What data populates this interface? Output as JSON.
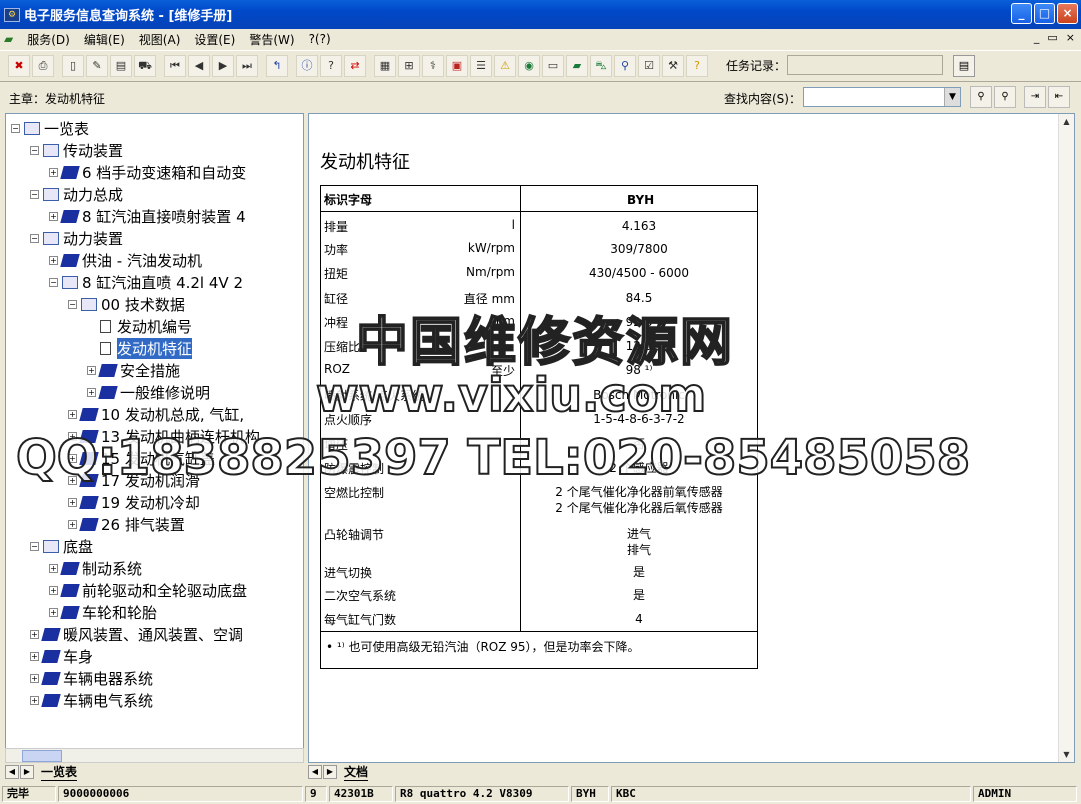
{
  "window": {
    "title": "电子服务信息查询系统 - [维修手册]"
  },
  "menu": {
    "items": [
      "服务(D)",
      "编辑(E)",
      "视图(A)",
      "设置(E)",
      "警告(W)",
      "?(?)"
    ],
    "right_controls": [
      "_",
      "▭",
      "×"
    ]
  },
  "toolbar": {
    "task_label": "任务记录："
  },
  "address": {
    "chapter": "主章：发动机特征",
    "find_label": "查找内容(S)："
  },
  "tree": {
    "items": [
      {
        "label": "一览表",
        "level": 0,
        "pm": "−",
        "icon": "open"
      },
      {
        "label": "传动装置",
        "level": 1,
        "pm": "−",
        "icon": "open"
      },
      {
        "label": "6 档手动变速箱和自动变",
        "level": 2,
        "pm": "+",
        "icon": "closed"
      },
      {
        "label": "动力总成",
        "level": 1,
        "pm": "−",
        "icon": "open"
      },
      {
        "label": "8 缸汽油直接喷射装置 4",
        "level": 2,
        "pm": "+",
        "icon": "closed"
      },
      {
        "label": "动力装置",
        "level": 1,
        "pm": "−",
        "icon": "open"
      },
      {
        "label": "供油 - 汽油发动机",
        "level": 2,
        "pm": "+",
        "icon": "closed"
      },
      {
        "label": "8 缸汽油直喷 4.2l 4V 2",
        "level": 2,
        "pm": "−",
        "icon": "open"
      },
      {
        "label": "00 技术数据",
        "level": 3,
        "pm": "−",
        "icon": "open"
      },
      {
        "label": "发动机编号",
        "level": 4,
        "pm": "",
        "icon": "page"
      },
      {
        "label": "发动机特征",
        "level": 4,
        "pm": "",
        "icon": "page",
        "selected": true
      },
      {
        "label": "安全措施",
        "level": 4,
        "pm": "+",
        "icon": "closed"
      },
      {
        "label": "一般维修说明",
        "level": 4,
        "pm": "+",
        "icon": "closed"
      },
      {
        "label": "10 发动机总成, 气缸,",
        "level": 3,
        "pm": "+",
        "icon": "closed"
      },
      {
        "label": "13 发动机曲柄连杆机构",
        "level": 3,
        "pm": "+",
        "icon": "closed"
      },
      {
        "label": "15 发动机气缸盖",
        "level": 3,
        "pm": "+",
        "icon": "closed"
      },
      {
        "label": "17 发动机润滑",
        "level": 3,
        "pm": "+",
        "icon": "closed"
      },
      {
        "label": "19 发动机冷却",
        "level": 3,
        "pm": "+",
        "icon": "closed"
      },
      {
        "label": "26 排气装置",
        "level": 3,
        "pm": "+",
        "icon": "closed"
      },
      {
        "label": "底盘",
        "level": 1,
        "pm": "−",
        "icon": "open"
      },
      {
        "label": "制动系统",
        "level": 2,
        "pm": "+",
        "icon": "closed"
      },
      {
        "label": "前轮驱动和全轮驱动底盘",
        "level": 2,
        "pm": "+",
        "icon": "closed"
      },
      {
        "label": "车轮和轮胎",
        "level": 2,
        "pm": "+",
        "icon": "closed"
      },
      {
        "label": "暖风装置、通风装置、空调",
        "level": 1,
        "pm": "+",
        "icon": "closed"
      },
      {
        "label": "车身",
        "level": 1,
        "pm": "+",
        "icon": "closed"
      },
      {
        "label": "车辆电器系统",
        "level": 1,
        "pm": "+",
        "icon": "closed"
      },
      {
        "label": "车辆电气系统",
        "level": 1,
        "pm": "+",
        "icon": "closed"
      }
    ]
  },
  "left_tab": "一览表",
  "right_tab": "文档",
  "doc": {
    "title": "发动机特征",
    "header": {
      "label": "标识字母",
      "value": "BYH"
    },
    "rows": [
      {
        "label": "排量",
        "unit": "l",
        "value": "4.163"
      },
      {
        "label": "功率",
        "unit": "kW/rpm",
        "value": "309/7800"
      },
      {
        "label": "扭矩",
        "unit": "Nm/rpm",
        "value": "430/4500 - 6000"
      },
      {
        "label": "缸径",
        "unit": "直径 mm",
        "value": "84.5"
      },
      {
        "label": "冲程",
        "unit": "mm",
        "value": "92.8"
      },
      {
        "label": "压缩比",
        "unit": "",
        "value": "12.5"
      },
      {
        "label": "ROZ",
        "unit": "至少",
        "value": "98 ¹⁾"
      },
      {
        "label": "喷射系统/点火系统",
        "unit": "",
        "value": "Bosch Motronic"
      },
      {
        "label": "点火顺序",
        "unit": "",
        "value": "1-5-4-8-6-3-7-2"
      },
      {
        "label": "增压",
        "unit": "",
        "value": "否"
      },
      {
        "label": "防爆震控制",
        "unit": "",
        "value": "2 个感应器"
      },
      {
        "label": "空燃比控制",
        "unit": "",
        "value": "2 个尾气催化净化器前氧传感器\n2 个尾气催化净化器后氧传感器"
      },
      {
        "label": "凸轮轴调节",
        "unit": "",
        "value": "进气\n排气"
      },
      {
        "label": "进气切换",
        "unit": "",
        "value": "是"
      },
      {
        "label": "二次空气系统",
        "unit": "",
        "value": "是"
      },
      {
        "label": "每气缸气门数",
        "unit": "",
        "value": "4"
      }
    ],
    "footnote": "•   ¹⁾  也可使用高级无铅汽油（ROZ 95），但是功率会下降。"
  },
  "watermark": {
    "line1": "中国维修资源网",
    "line2": "www.vixiu.com",
    "line3": "QQ:1838825397 TEL:020-85485058"
  },
  "status": {
    "ready": "完毕",
    "code": "9000000006",
    "num": "9",
    "part": "42301B",
    "model": "R8 quattro 4.2 V8309",
    "engine": "BYH",
    "gear": "KBC",
    "user": "ADMIN"
  }
}
